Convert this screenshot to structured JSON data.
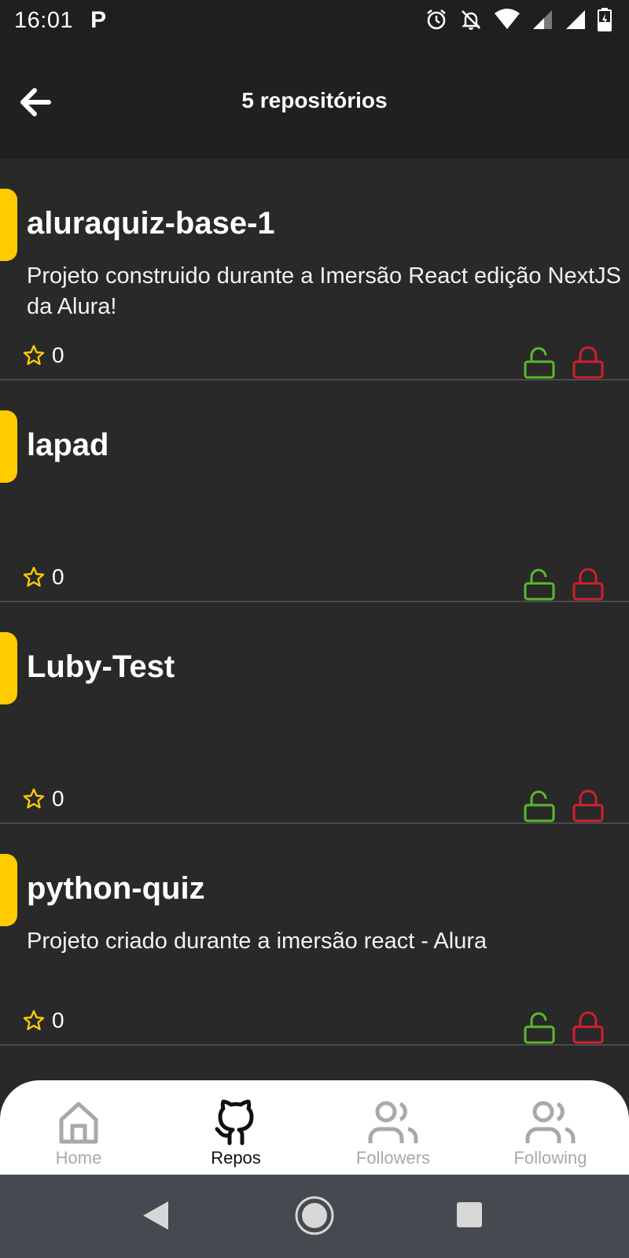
{
  "status_bar": {
    "time": "16:01",
    "app_glyph": "P"
  },
  "app_bar": {
    "title": "5 repositórios"
  },
  "repos": [
    {
      "name": "aluraquiz-base-1",
      "description": "Projeto construido durante a Imersão React edição NextJS da Alura!",
      "stars": "0"
    },
    {
      "name": "lapad",
      "description": "",
      "stars": "0"
    },
    {
      "name": "Luby-Test",
      "description": "",
      "stars": "0"
    },
    {
      "name": "python-quiz",
      "description": "Projeto criado durante a imersão react - Alura",
      "stars": "0"
    }
  ],
  "bottom_nav": {
    "items": [
      {
        "label": "Home",
        "icon": "home-icon"
      },
      {
        "label": "Repos",
        "icon": "github-icon"
      },
      {
        "label": "Followers",
        "icon": "users-icon"
      },
      {
        "label": "Following",
        "icon": "users-icon"
      }
    ],
    "active": "Repos"
  },
  "colors": {
    "background": "#292929",
    "accent": "#ffcc00",
    "unlock": "#5cb82a",
    "lock": "#d0202e"
  }
}
